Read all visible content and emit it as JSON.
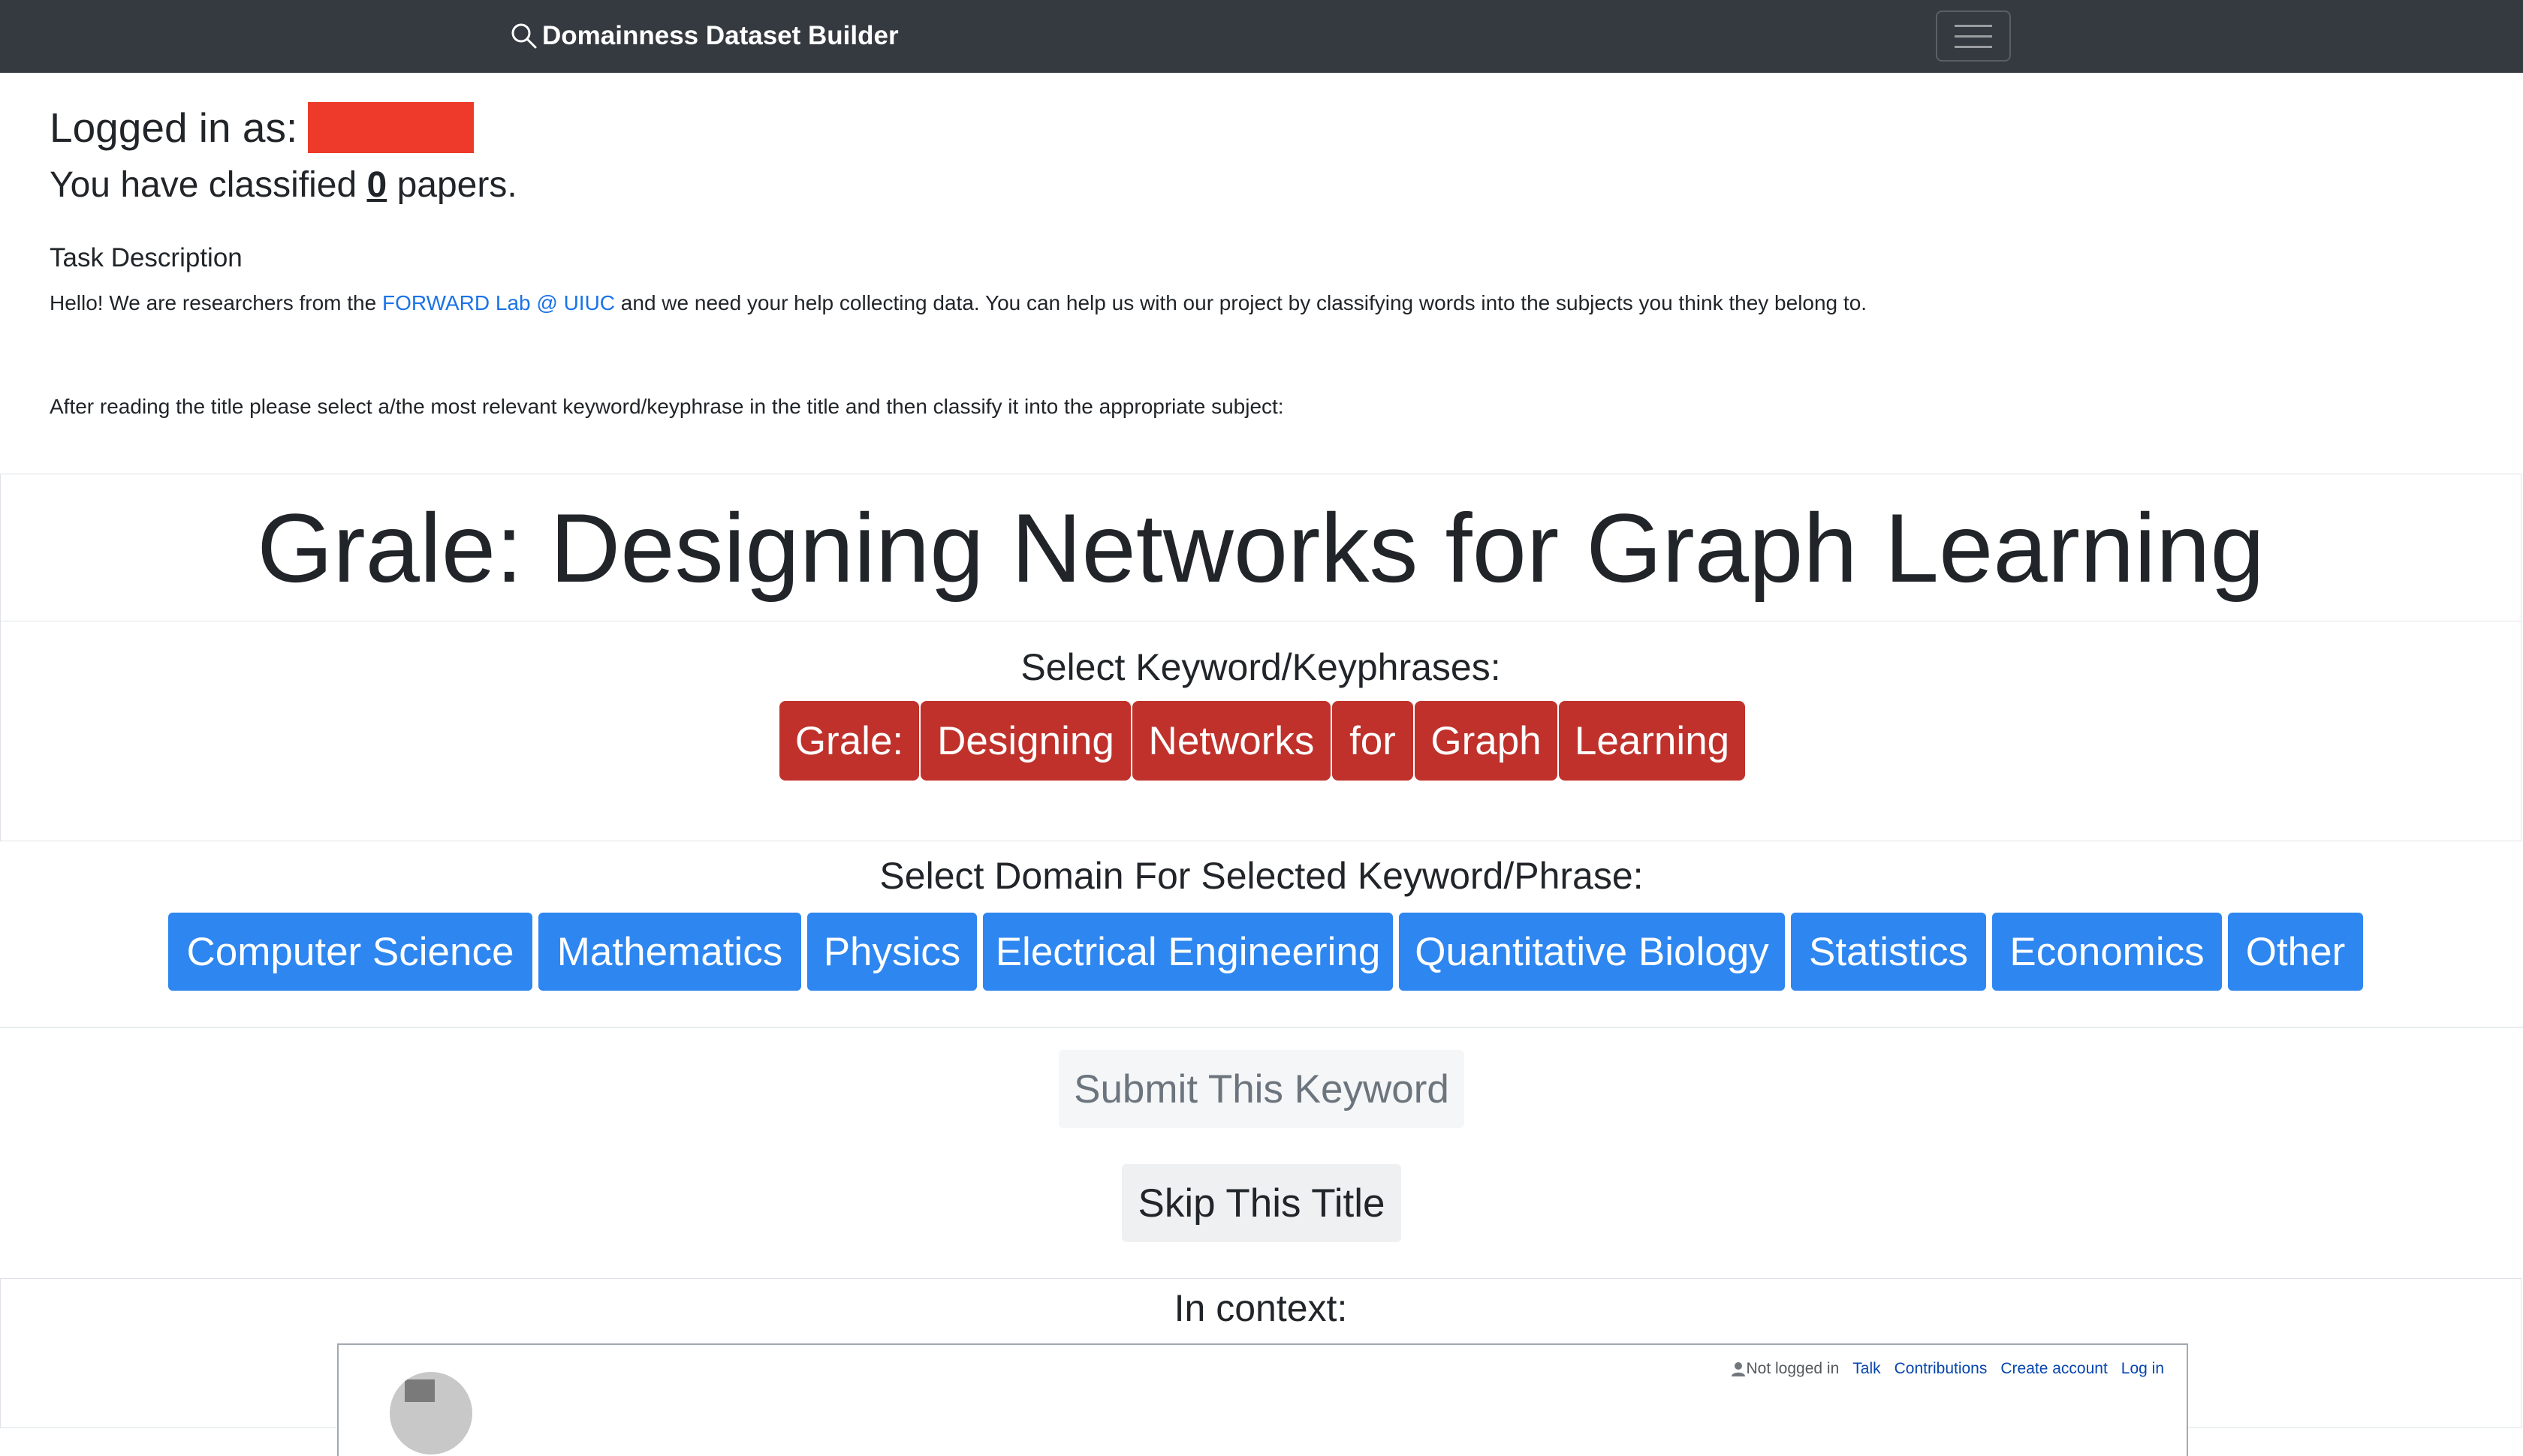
{
  "navbar": {
    "brand": "Domainness Dataset Builder",
    "brand_icon": "search-icon",
    "toggler_icon": "hamburger-menu-icon"
  },
  "user": {
    "logged_in_label": "Logged in as:",
    "classified_prefix": "You have classified",
    "classified_count": "0",
    "classified_suffix": "papers."
  },
  "task": {
    "heading": "Task Description",
    "intro_before": "Hello! We are researchers from the",
    "lab_link": "FORWARD Lab @ UIUC",
    "intro_after": "and we need your help collecting data. You can help us with our project by classifying words into the subjects you think they belong to.",
    "instructions": "After reading the title please select a/the most relevant keyword/keyphrase in the title and then classify it into the appropriate subject:"
  },
  "paper": {
    "title": "Grale: Designing Networks for Graph Learning"
  },
  "keywords": {
    "heading": "Select Keyword/Keyphrases:",
    "items": [
      "Grale:",
      "Designing",
      "Networks",
      "for",
      "Graph",
      "Learning"
    ]
  },
  "domains": {
    "heading": "Select Domain For Selected Keyword/Phrase:",
    "items": [
      "Computer Science",
      "Mathematics",
      "Physics",
      "Electrical Engineering",
      "Quantitative Biology",
      "Statistics",
      "Economics",
      "Other"
    ]
  },
  "actions": {
    "submit": "Submit This Keyword",
    "skip": "Skip This Title"
  },
  "context": {
    "heading": "In context:",
    "wiki_user_status": "Not logged in",
    "wiki_links": [
      "Talk",
      "Contributions",
      "Create account",
      "Log in"
    ]
  },
  "colors": {
    "navbar": "#343a40",
    "keyword": "#c0312b",
    "domain": "#2e86f0",
    "link": "#1a73e8",
    "redaction": "#ee3a2a"
  }
}
